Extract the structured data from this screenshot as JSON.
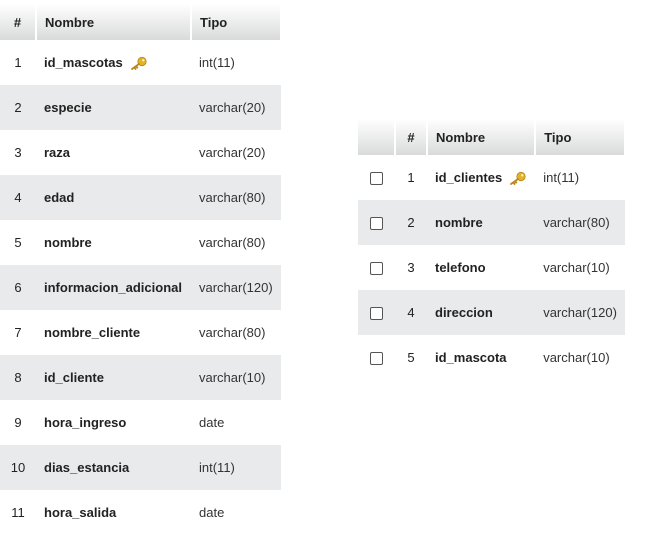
{
  "headers": {
    "num": "#",
    "name": "Nombre",
    "type": "Tipo"
  },
  "mascotas_table": {
    "rows": [
      {
        "num": "1",
        "name": "id_mascotas",
        "type": "int(11)",
        "key": true
      },
      {
        "num": "2",
        "name": "especie",
        "type": "varchar(20)"
      },
      {
        "num": "3",
        "name": "raza",
        "type": "varchar(20)"
      },
      {
        "num": "4",
        "name": "edad",
        "type": "varchar(80)"
      },
      {
        "num": "5",
        "name": "nombre",
        "type": "varchar(80)"
      },
      {
        "num": "6",
        "name": "informacion_adicional",
        "type": "varchar(120)"
      },
      {
        "num": "7",
        "name": "nombre_cliente",
        "type": "varchar(80)"
      },
      {
        "num": "8",
        "name": "id_cliente",
        "type": "varchar(10)"
      },
      {
        "num": "9",
        "name": "hora_ingreso",
        "type": "date"
      },
      {
        "num": "10",
        "name": "dias_estancia",
        "type": "int(11)"
      },
      {
        "num": "11",
        "name": "hora_salida",
        "type": "date"
      }
    ]
  },
  "clientes_table": {
    "rows": [
      {
        "num": "1",
        "name": "id_clientes",
        "type": "int(11)",
        "key": true
      },
      {
        "num": "2",
        "name": "nombre",
        "type": "varchar(80)"
      },
      {
        "num": "3",
        "name": "telefono",
        "type": "varchar(10)"
      },
      {
        "num": "4",
        "name": "direccion",
        "type": "varchar(120)"
      },
      {
        "num": "5",
        "name": "id_mascota",
        "type": "varchar(10)"
      }
    ]
  },
  "icons": {
    "primary_key": "key-icon",
    "checkbox": "checkbox"
  },
  "colors": {
    "header_gradient_top": "#ffffff",
    "header_gradient_bottom": "#d9dadb",
    "row_alt": "#e9eaeb",
    "key": "#e2b325"
  }
}
